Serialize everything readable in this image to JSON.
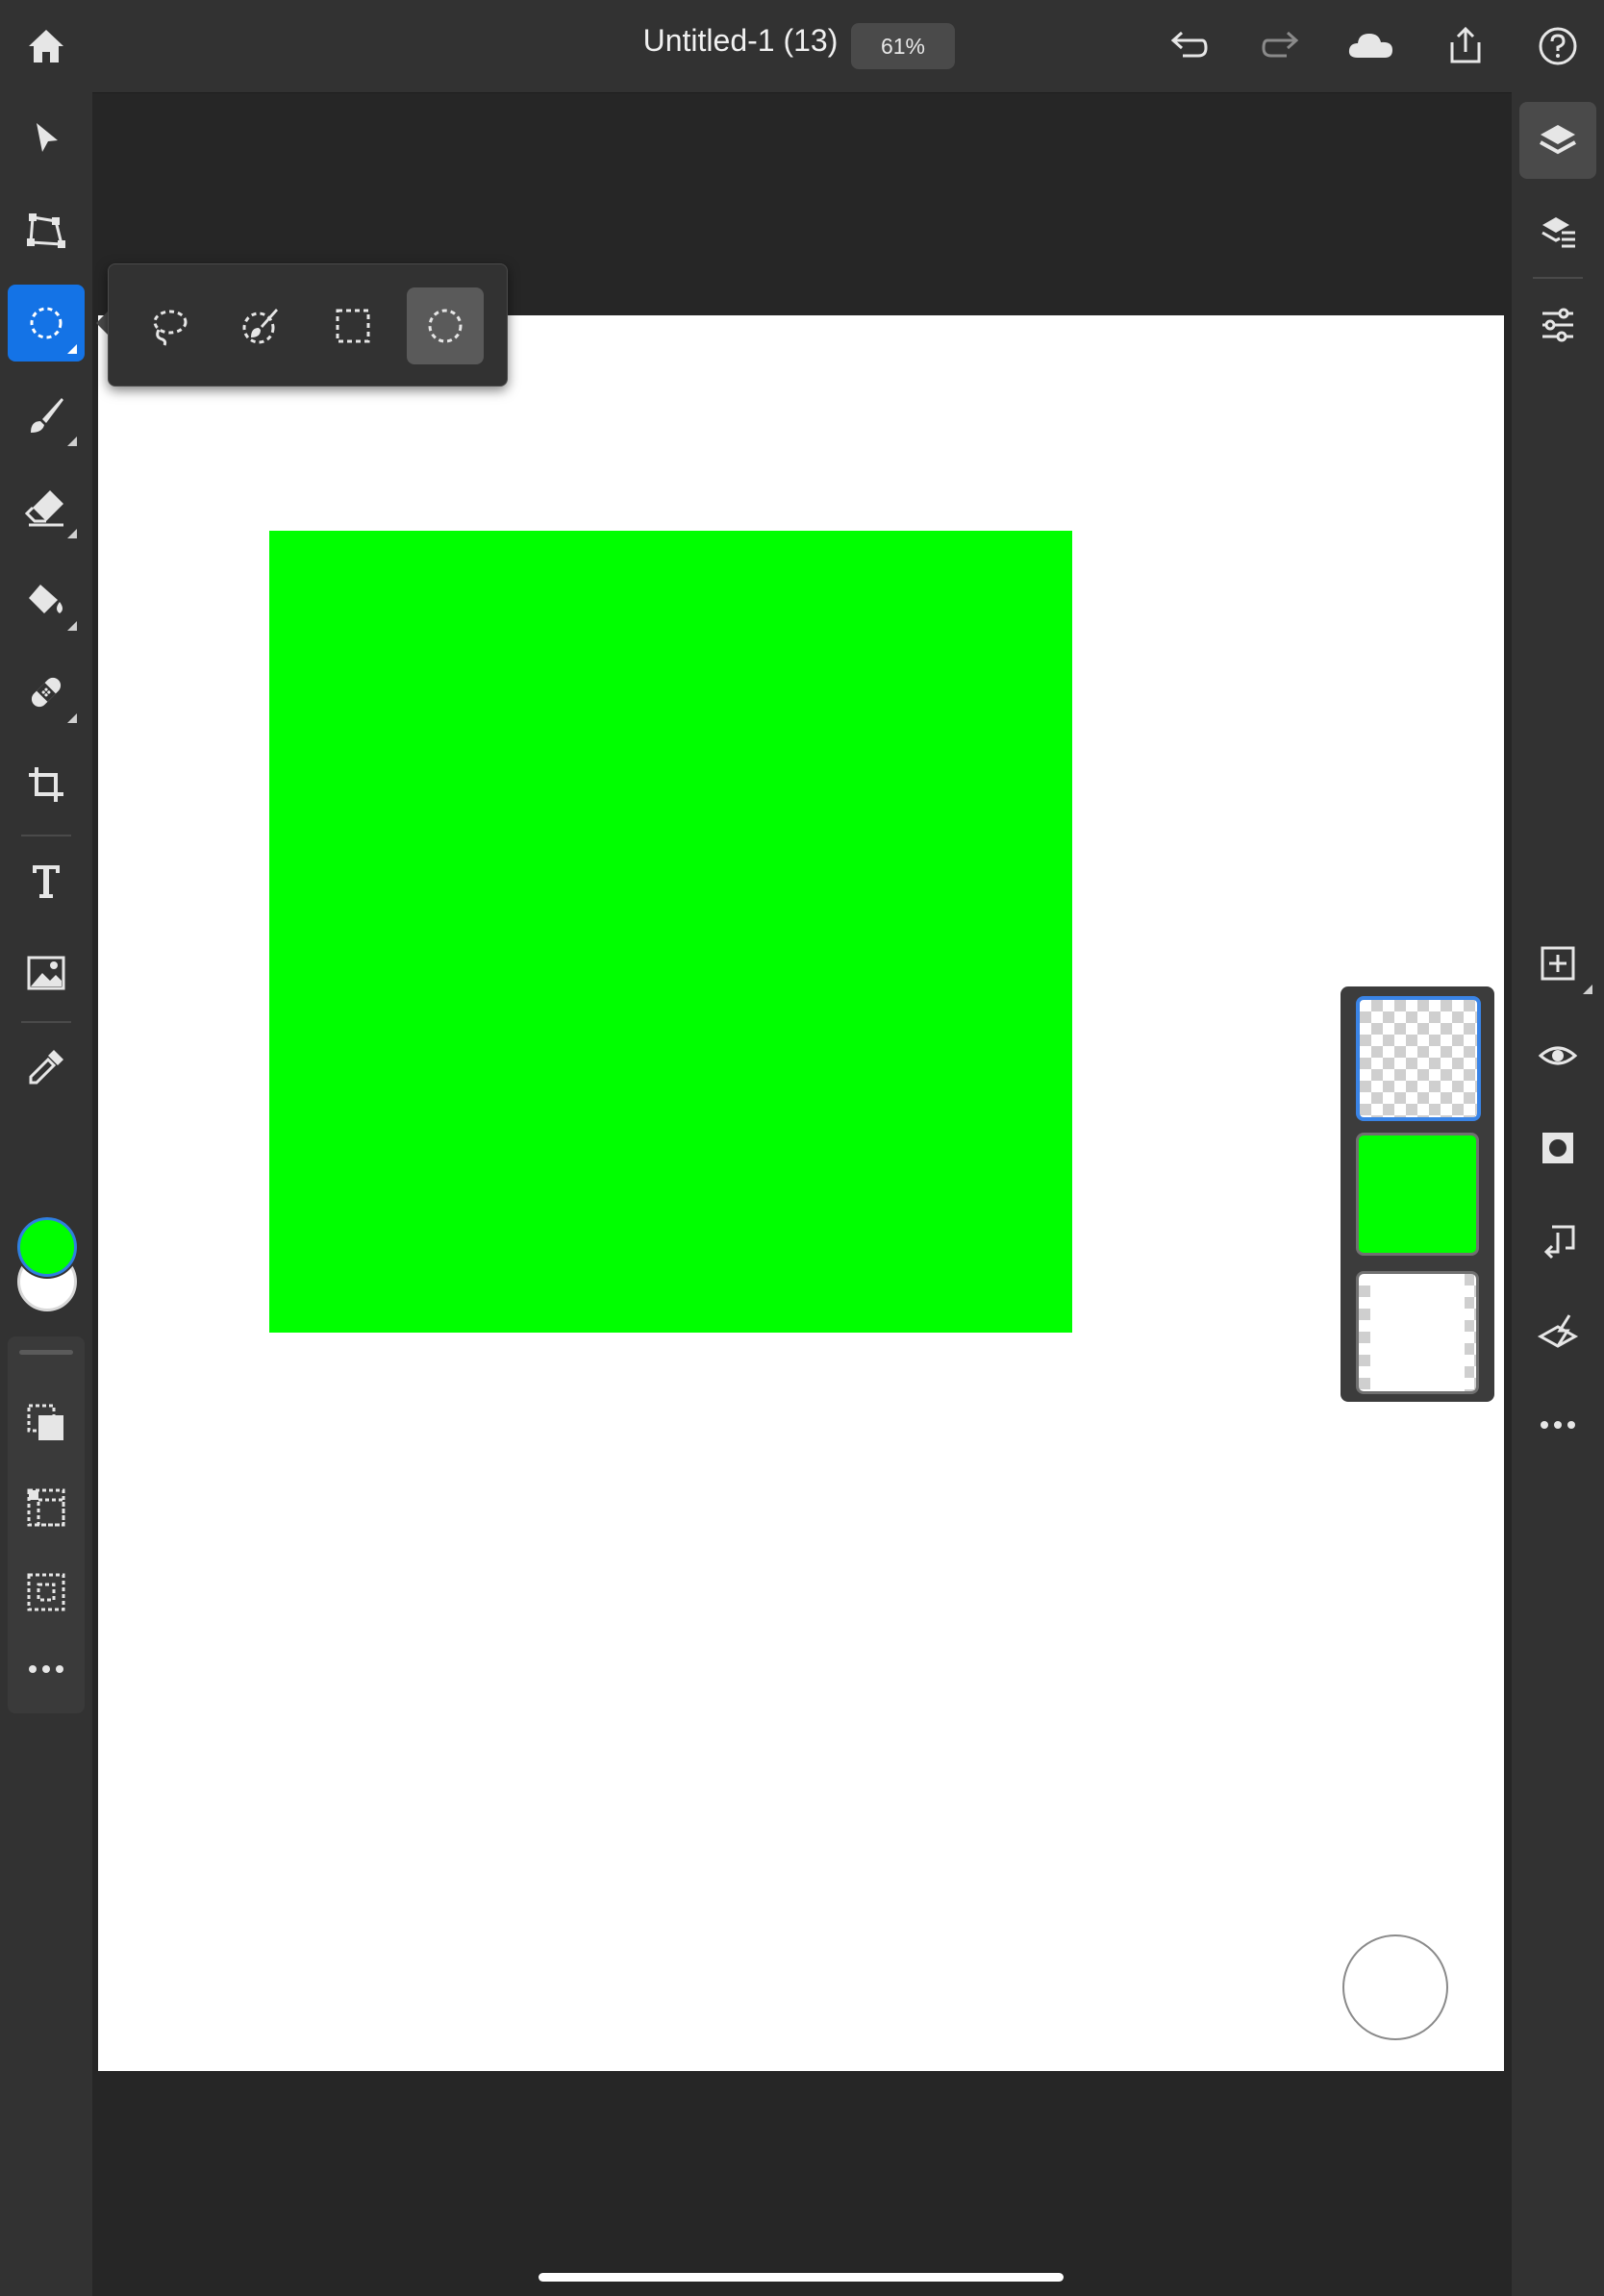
{
  "app": {
    "document_title": "Untitled-1 (13)",
    "zoom_level": "61%"
  },
  "top_bar": {
    "icons": [
      "home-icon",
      "undo-icon",
      "redo-icon",
      "cloud-icon",
      "share-icon",
      "help-icon"
    ]
  },
  "left_toolbar": {
    "tools": [
      "select-move-icon",
      "transform-icon",
      "ellipse-select-icon",
      "brush-icon",
      "eraser-icon",
      "fill-icon",
      "healing-icon",
      "crop-icon",
      "type-icon",
      "image-icon",
      "eyedropper-icon"
    ],
    "active_tool": "ellipse-select",
    "primary_color": "#00ff00",
    "secondary_color": "#ffffff",
    "selection_tools": [
      "select-subject-icon",
      "select-inverse-icon",
      "deselect-icon",
      "more-icon"
    ]
  },
  "subtool_tray": {
    "items": [
      "lasso-icon",
      "quick-select-brush-icon",
      "rectangle-select-icon",
      "ellipse-select-icon"
    ],
    "selected": "ellipse-select-icon"
  },
  "right_toolbar": {
    "tools": [
      "layers-icon",
      "layer-properties-icon",
      "adjustments-icon",
      "add-layer-icon",
      "visibility-icon",
      "mask-icon",
      "merge-down-icon",
      "clear-layer-icon",
      "more-icon"
    ],
    "active_tool": "layers-icon"
  },
  "canvas": {
    "background": "#ffffff",
    "shape_color": "#00ff00"
  },
  "layers": [
    {
      "type": "transparent",
      "selected": true
    },
    {
      "type": "green-fill",
      "selected": false
    },
    {
      "type": "white-background",
      "selected": false
    }
  ],
  "colors": {
    "accent": "#1473e6",
    "ui_dark": "#323232",
    "workspace": "#262626"
  }
}
